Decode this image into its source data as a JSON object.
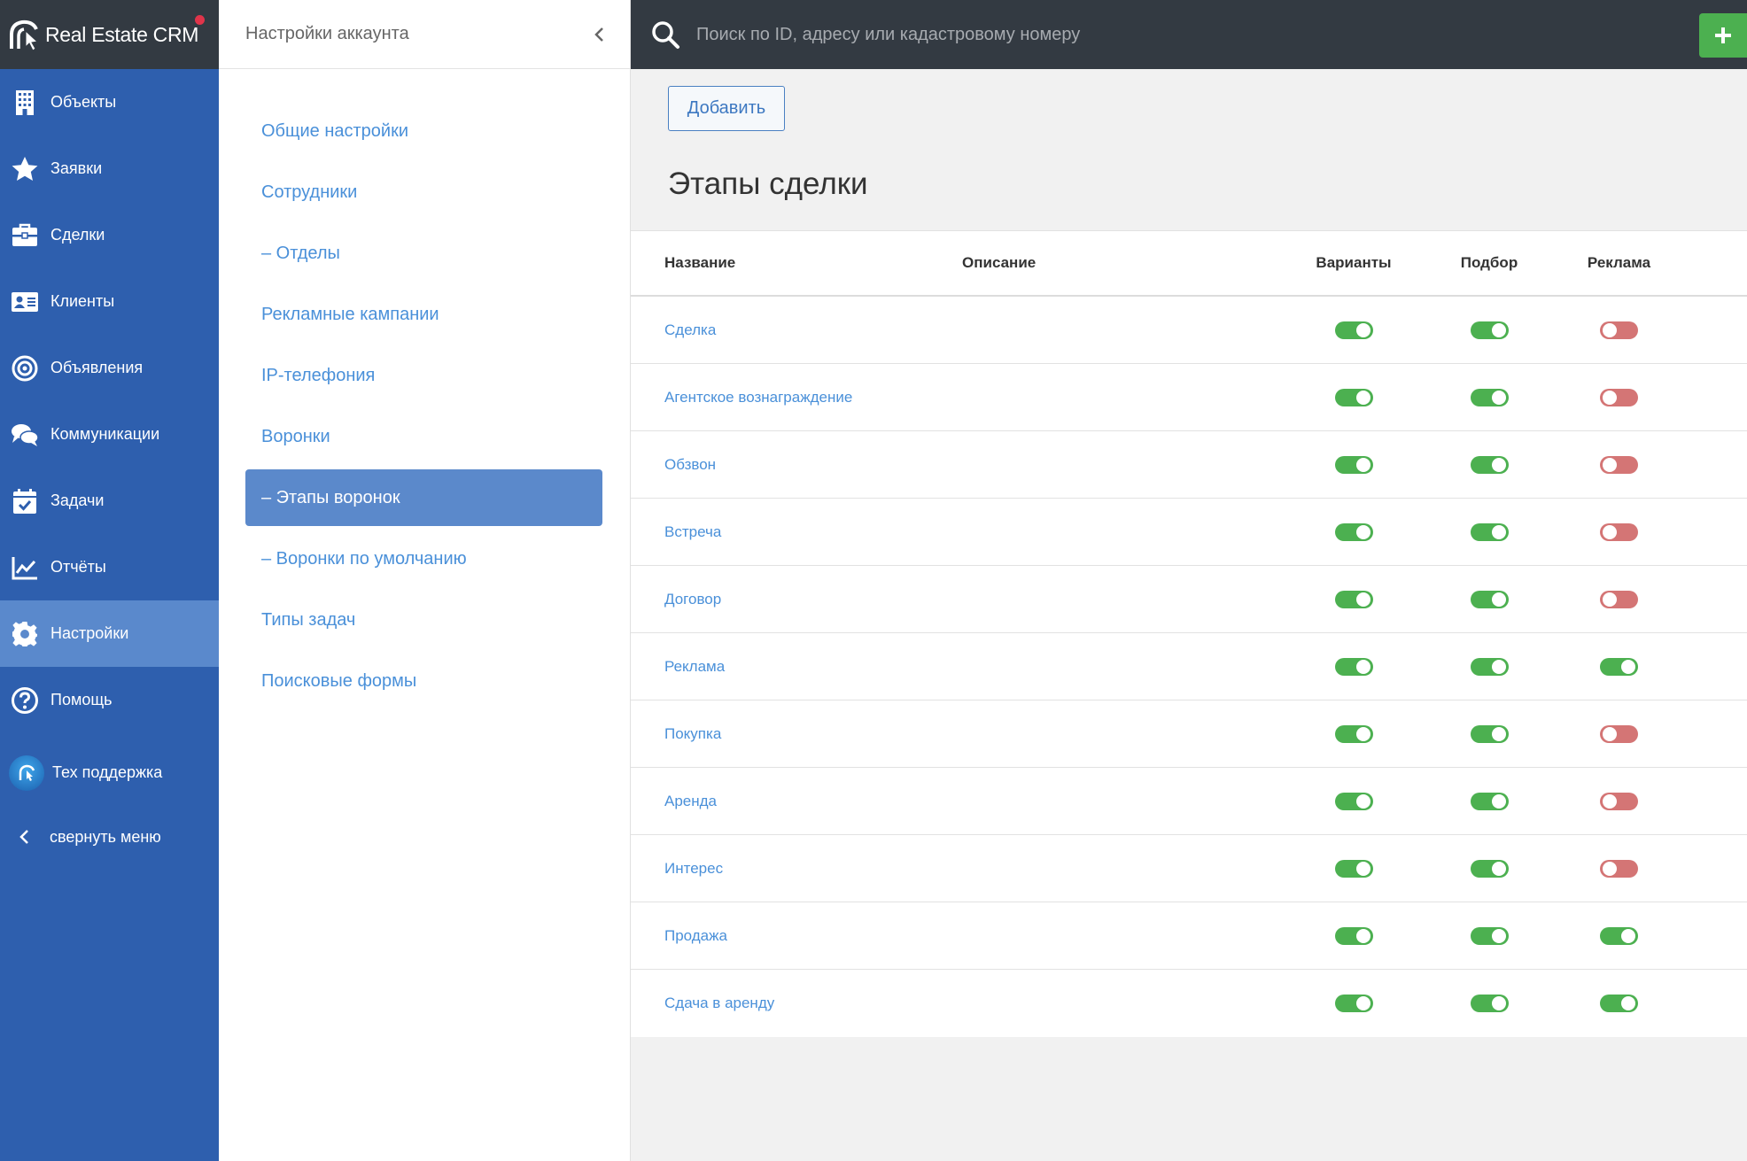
{
  "brand": {
    "name": "Real Estate CRM"
  },
  "nav": {
    "items": [
      {
        "label": "Объекты",
        "icon": "building-icon"
      },
      {
        "label": "Заявки",
        "icon": "star-icon"
      },
      {
        "label": "Сделки",
        "icon": "briefcase-icon"
      },
      {
        "label": "Клиенты",
        "icon": "contact-card-icon"
      },
      {
        "label": "Объявления",
        "icon": "target-icon"
      },
      {
        "label": "Коммуникации",
        "icon": "chat-icon"
      },
      {
        "label": "Задачи",
        "icon": "calendar-check-icon"
      },
      {
        "label": "Отчёты",
        "icon": "chart-line-icon"
      },
      {
        "label": "Настройки",
        "icon": "gear-icon",
        "active": true
      },
      {
        "label": "Помощь",
        "icon": "help-icon"
      }
    ],
    "support_label": "Тех поддержка",
    "collapse_label": "свернуть меню"
  },
  "settings": {
    "title": "Настройки аккаунта",
    "menu": [
      "Общие настройки",
      "Сотрудники",
      "– Отделы",
      "Рекламные кампании",
      "IP-телефония",
      "Воронки",
      "– Этапы воронок",
      "– Воронки по умолчанию",
      "Типы задач",
      "Поисковые формы"
    ],
    "active_index": 6
  },
  "topbar": {
    "search_placeholder": "Поиск по ID, адресу или кадастровому номеру"
  },
  "main": {
    "add_label": "Добавить",
    "title": "Этапы сделки",
    "columns": {
      "name": "Название",
      "description": "Описание",
      "variants": "Варианты",
      "selection": "Подбор",
      "advertising": "Реклама"
    },
    "rows": [
      {
        "name": "Сделка",
        "description": "",
        "variants": true,
        "selection": true,
        "advertising": false
      },
      {
        "name": "Агентское вознаграждение",
        "description": "",
        "variants": true,
        "selection": true,
        "advertising": false
      },
      {
        "name": "Обзвон",
        "description": "",
        "variants": true,
        "selection": true,
        "advertising": false
      },
      {
        "name": "Встреча",
        "description": "",
        "variants": true,
        "selection": true,
        "advertising": false
      },
      {
        "name": "Договор",
        "description": "",
        "variants": true,
        "selection": true,
        "advertising": false
      },
      {
        "name": "Реклама",
        "description": "",
        "variants": true,
        "selection": true,
        "advertising": true
      },
      {
        "name": "Покупка",
        "description": "",
        "variants": true,
        "selection": true,
        "advertising": false
      },
      {
        "name": "Аренда",
        "description": "",
        "variants": true,
        "selection": true,
        "advertising": false
      },
      {
        "name": "Интерес",
        "description": "",
        "variants": true,
        "selection": true,
        "advertising": false
      },
      {
        "name": "Продажа",
        "description": "",
        "variants": true,
        "selection": true,
        "advertising": true
      },
      {
        "name": "Сдача в аренду",
        "description": "",
        "variants": true,
        "selection": true,
        "advertising": true
      }
    ]
  },
  "colors": {
    "sidebar": "#2e5fae",
    "sidebar_active": "#5a89cc",
    "topbar": "#333a42",
    "toggle_on": "#4cb050",
    "toggle_off": "#d47575",
    "link": "#4a90d9"
  }
}
